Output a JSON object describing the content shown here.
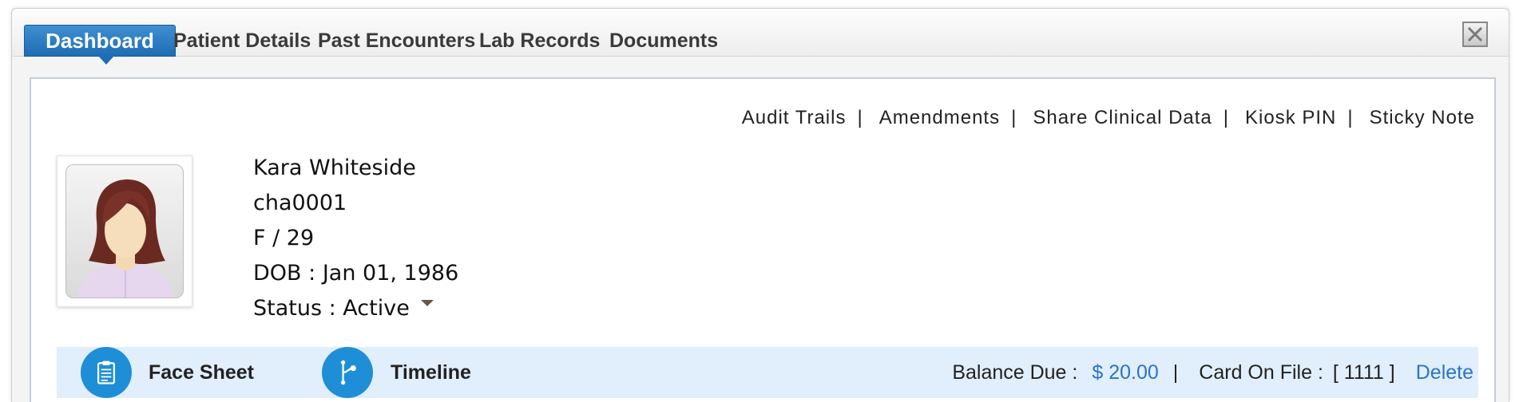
{
  "tabs": {
    "active": "Dashboard",
    "items": [
      "Patient Details",
      "Past Encounters",
      "Lab Records",
      "Documents"
    ]
  },
  "actions": [
    "Audit Trails",
    "Amendments",
    "Share Clinical Data",
    "Kiosk PIN",
    "Sticky Note"
  ],
  "patient": {
    "name": "Kara Whiteside",
    "id": "cha0001",
    "sex_age": "F / 29",
    "dob": "DOB : Jan 01, 1986",
    "status": "Status : Active"
  },
  "bottom_bar": {
    "face_sheet": "Face Sheet",
    "timeline": "Timeline",
    "balance_label": "Balance Due :",
    "balance_value": "$ 20.00",
    "card_label": "Card On File :",
    "card_value": "[ 1111 ]",
    "delete_label": "Delete"
  },
  "colors": {
    "accent": "#1f6db4",
    "icon_blue": "#1e8fd6",
    "link_blue": "#2a74c9",
    "bar_bg": "#e1eefb"
  },
  "icons": {
    "close": "close-icon",
    "status_dropdown": "chevron-down-icon",
    "face_sheet": "clipboard-icon",
    "timeline": "branch-icon",
    "avatar": "female-avatar-icon"
  }
}
